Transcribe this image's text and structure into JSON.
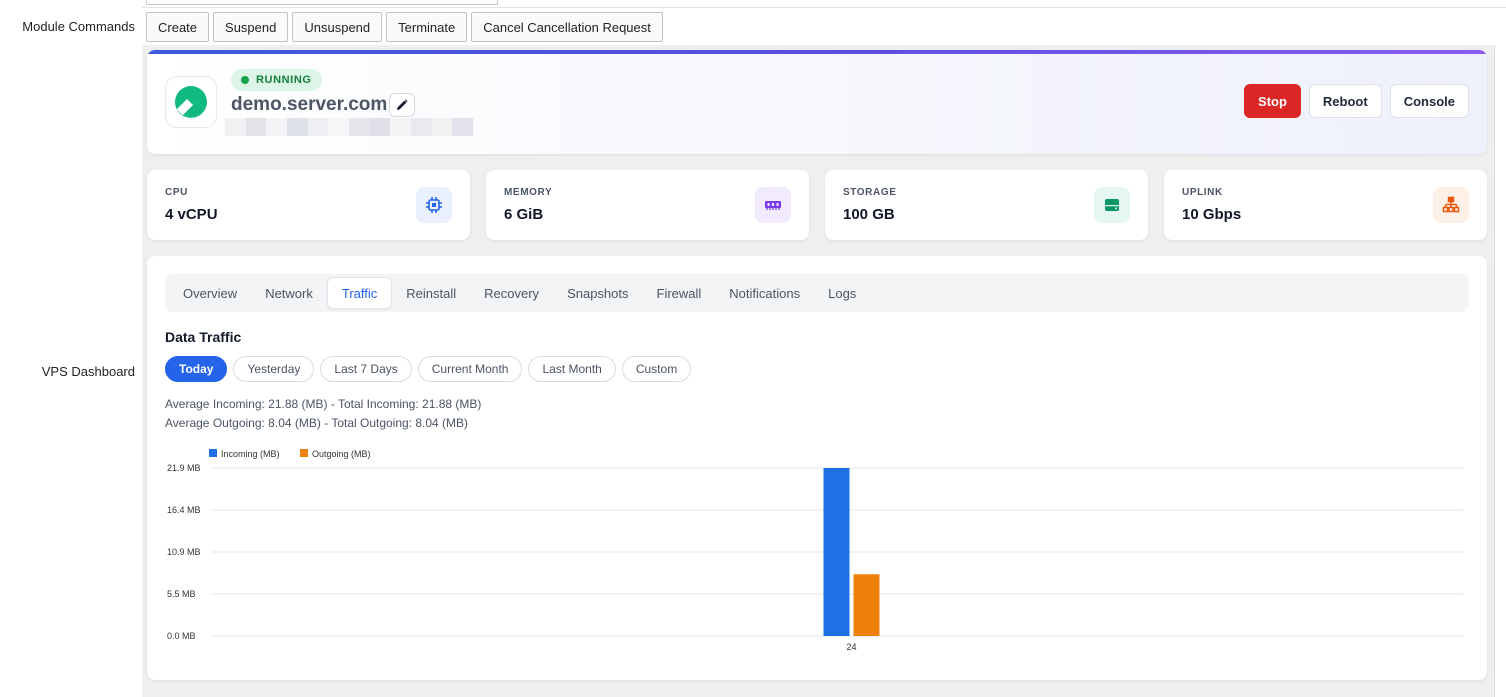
{
  "admin": {
    "module_commands_label": "Module Commands",
    "vps_dashboard_label": "VPS Dashboard",
    "commands": [
      "Create",
      "Suspend",
      "Unsuspend",
      "Terminate",
      "Cancel Cancellation Request"
    ]
  },
  "server": {
    "status": "RUNNING",
    "hostname": "demo.server.com",
    "actions": {
      "stop": "Stop",
      "reboot": "Reboot",
      "console": "Console"
    },
    "status_color": "#16a34a",
    "stop_color": "#dc2626"
  },
  "stats": [
    {
      "label": "CPU",
      "value": "4 vCPU",
      "icon": "cpu-icon",
      "color": "#2563eb",
      "bg": "#eaf0fd"
    },
    {
      "label": "MEMORY",
      "value": "6 GiB",
      "icon": "memory-icon",
      "color": "#7c3aed",
      "bg": "#f1ebfd"
    },
    {
      "label": "STORAGE",
      "value": "100 GB",
      "icon": "storage-icon",
      "color": "#059669",
      "bg": "#e6f7ef"
    },
    {
      "label": "UPLINK",
      "value": "10 Gbps",
      "icon": "network-icon",
      "color": "#ea580c",
      "bg": "#fdf0e7"
    }
  ],
  "tabs": [
    "Overview",
    "Network",
    "Traffic",
    "Reinstall",
    "Recovery",
    "Snapshots",
    "Firewall",
    "Notifications",
    "Logs"
  ],
  "active_tab": "Traffic",
  "traffic": {
    "title": "Data Traffic",
    "ranges": [
      "Today",
      "Yesterday",
      "Last 7 Days",
      "Current Month",
      "Last Month",
      "Custom"
    ],
    "active_range": "Today",
    "summary_incoming": "Average Incoming: 21.88 (MB) - Total Incoming: 21.88 (MB)",
    "summary_outgoing": "Average Outgoing: 8.04 (MB) - Total Outgoing: 8.04 (MB)"
  },
  "chart_data": {
    "type": "bar",
    "categories": [
      "24"
    ],
    "series": [
      {
        "name": "Incoming (MB)",
        "values": [
          21.88
        ],
        "color": "#1f6fe5"
      },
      {
        "name": "Outgoing (MB)",
        "values": [
          8.04
        ],
        "color": "#f0800c"
      }
    ],
    "yticks": [
      "0.0 MB",
      "5.5 MB",
      "10.9 MB",
      "16.4 MB",
      "21.9 MB"
    ],
    "ylim": [
      0,
      21.88
    ],
    "grid": true,
    "legend": "top-left"
  }
}
